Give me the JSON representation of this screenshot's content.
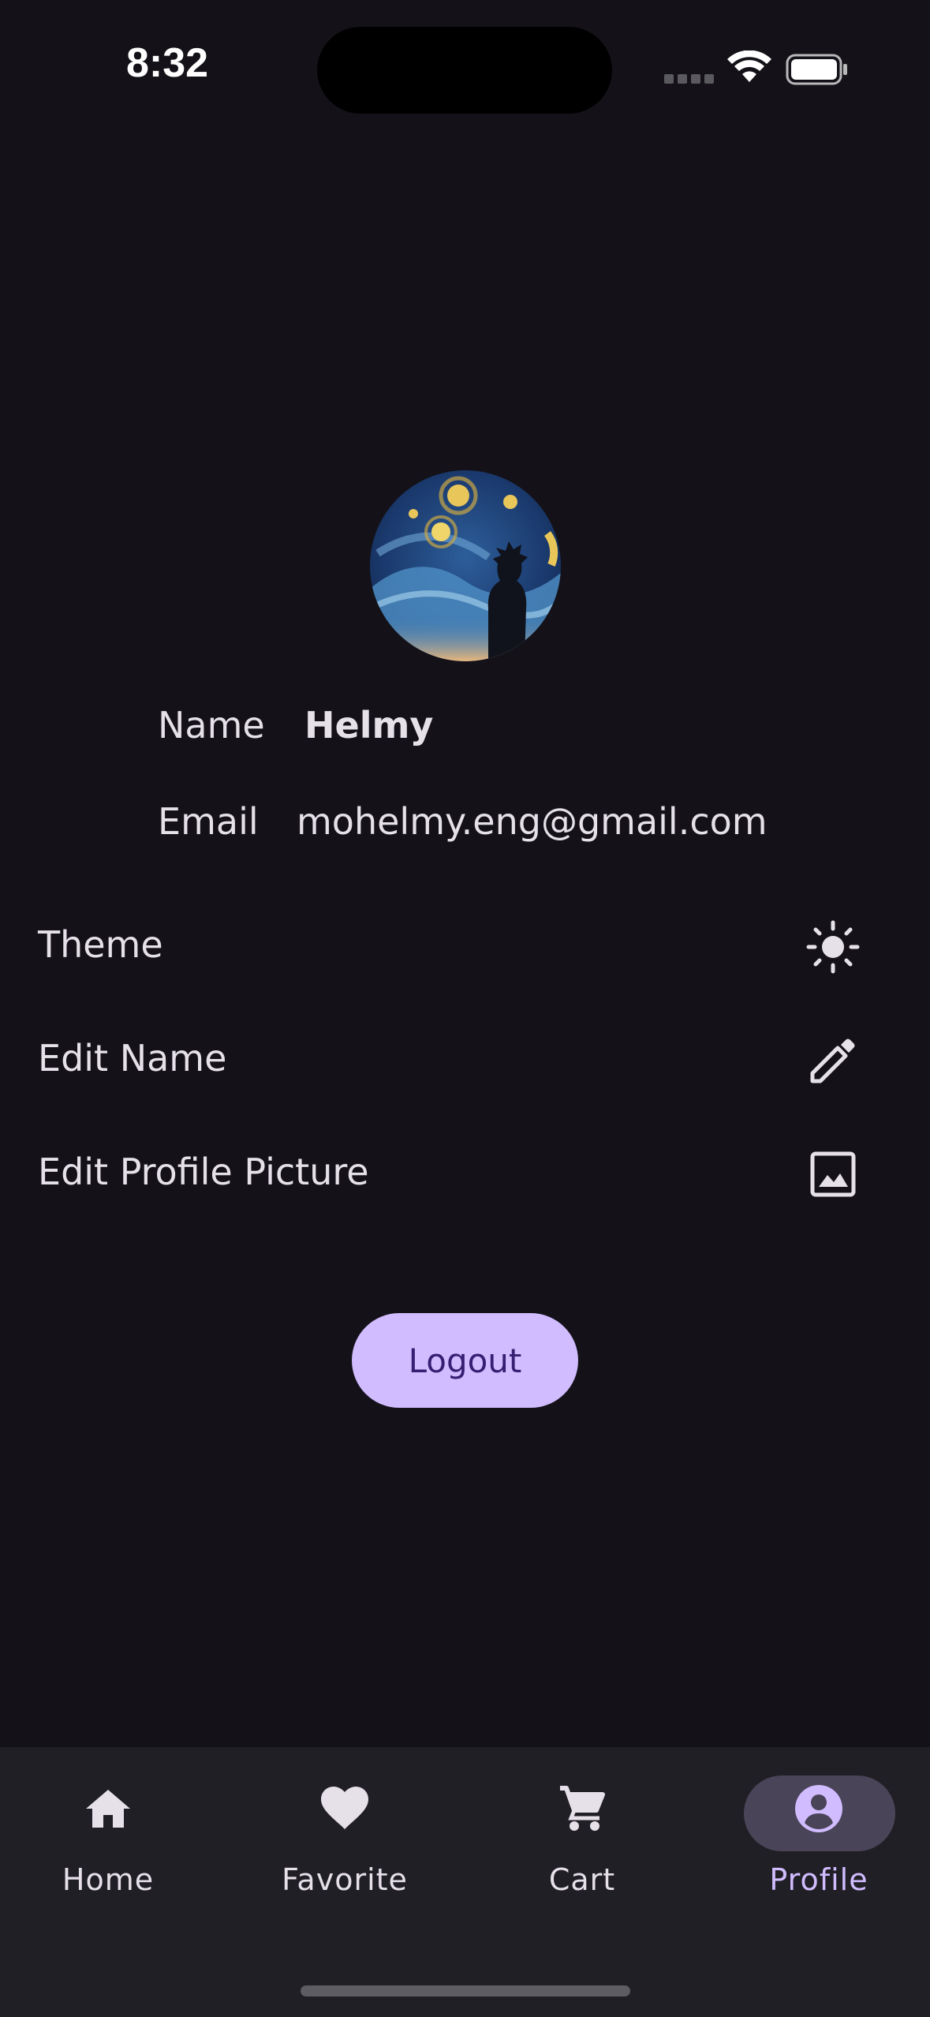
{
  "status_bar": {
    "time": "8:32"
  },
  "profile": {
    "name_label": "Name",
    "name_value": "Helmy",
    "email_label": "Email",
    "email_value": "mohelmy.eng@gmail.com"
  },
  "settings": {
    "theme_label": "Theme",
    "theme_icon": "sun-icon",
    "edit_name_label": "Edit Name",
    "edit_name_icon": "pencil-icon",
    "edit_picture_label": "Edit Profile Picture",
    "edit_picture_icon": "image-icon"
  },
  "logout_label": "Logout",
  "bottom_nav": {
    "items": [
      {
        "label": "Home",
        "icon": "home-icon",
        "selected": false
      },
      {
        "label": "Favorite",
        "icon": "heart-icon",
        "selected": false
      },
      {
        "label": "Cart",
        "icon": "cart-icon",
        "selected": false
      },
      {
        "label": "Profile",
        "icon": "account-circle-icon",
        "selected": true
      }
    ]
  },
  "colors": {
    "background": "#141218",
    "nav_background": "#211F26",
    "accent": "#D0BCFF",
    "on_accent": "#381E72",
    "selected_pill": "#4A4458",
    "text": "#E6E0E9"
  }
}
